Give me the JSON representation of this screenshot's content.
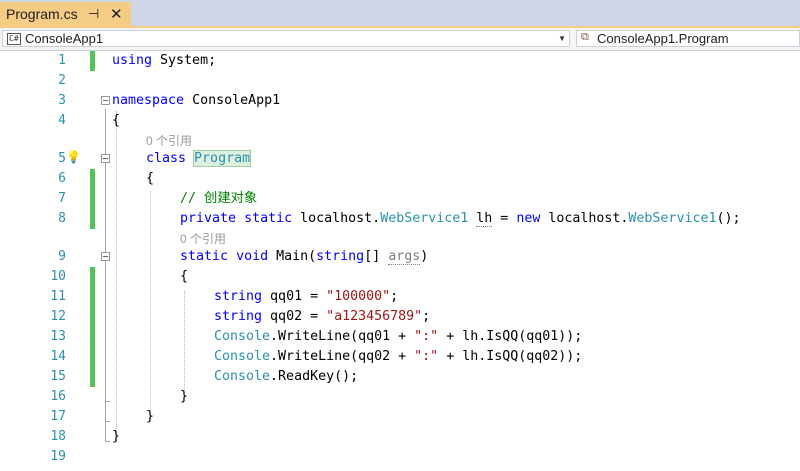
{
  "tab": {
    "filename": "Program.cs",
    "pin_glyph": "⊣",
    "close_glyph": "✕"
  },
  "navbar": {
    "project": "ConsoleApp1",
    "project_icon": "C#",
    "member": "ConsoleApp1.Program"
  },
  "editor": {
    "line_numbers": [
      "1",
      "2",
      "3",
      "4",
      "5",
      "6",
      "7",
      "8",
      "9",
      "10",
      "11",
      "12",
      "13",
      "14",
      "15",
      "16",
      "17",
      "18",
      "19"
    ],
    "code": {
      "l1_using": "using",
      "l1_rest": " System;",
      "l3_namespace": "namespace",
      "l3_name": " ConsoleApp1",
      "l4": "{",
      "lens_refs_class": "0 个引用",
      "l5_class": "class",
      "l5_name": "Program",
      "l6": "{",
      "l7_comment": "// 创建对象",
      "l8_private": "private",
      "l8_static": "static",
      "l8_localhost": "localhost.",
      "l8_type": "WebService1",
      "l8_lh": "lh",
      "l8_eq": " = ",
      "l8_new": "new",
      "l8_localhost2": " localhost.",
      "l8_type2": "WebService1",
      "l8_end": "();",
      "lens_refs_main": "0 个引用",
      "l9_static": "static",
      "l9_void": "void",
      "l9_main": " Main(",
      "l9_string": "string",
      "l9_arr": "[] ",
      "l9_args": "args",
      "l9_close": ")",
      "l10": "{",
      "l11_string": "string",
      "l11_var": " qq01 = ",
      "l11_val": "\"100000\"",
      "l11_end": ";",
      "l12_string": "string",
      "l12_var": " qq02 = ",
      "l12_val": "\"a123456789\"",
      "l12_end": ";",
      "l13_console": "Console",
      "l13_mid": ".WriteLine(qq01 + ",
      "l13_str": "\":\"",
      "l13_end": " + lh.IsQQ(qq01));",
      "l14_console": "Console",
      "l14_mid": ".WriteLine(qq02 + ",
      "l14_str": "\":\"",
      "l14_end": " + lh.IsQQ(qq02));",
      "l15_console": "Console",
      "l15_end": ".ReadKey();",
      "l16": "}",
      "l17": "}",
      "l18": "}"
    }
  },
  "colors": {
    "keyword": "#0000ff",
    "type": "#2b91af",
    "string": "#a31515",
    "comment": "#008000",
    "change_bar": "#57c15b",
    "active_tab": "#f5cc84"
  }
}
